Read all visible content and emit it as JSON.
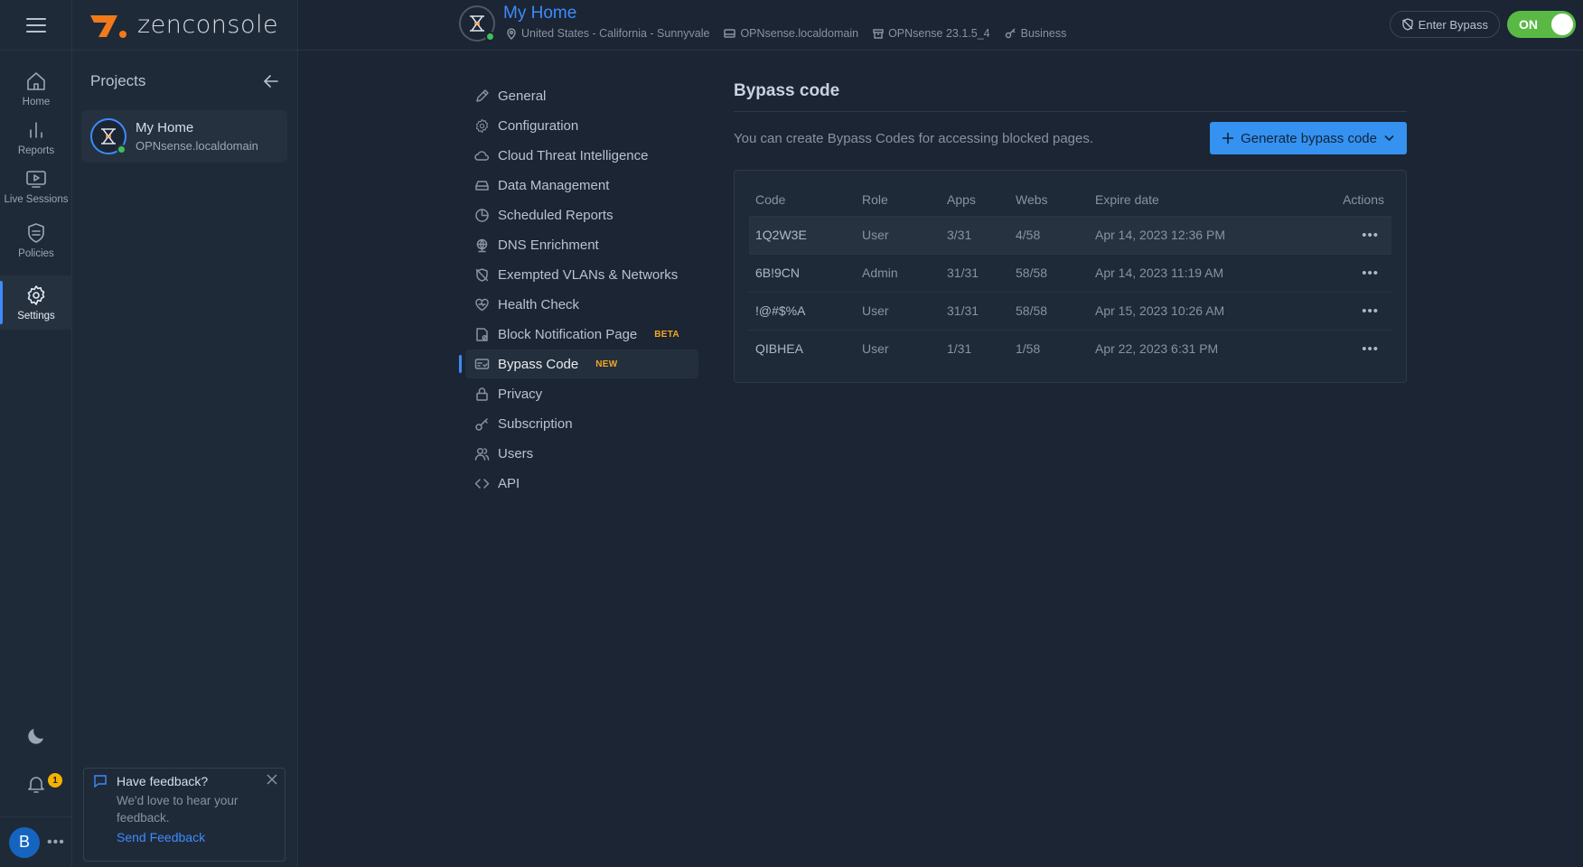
{
  "rail": {
    "items": [
      {
        "label": "Home",
        "icon": "home-icon"
      },
      {
        "label": "Reports",
        "icon": "bar-chart-icon"
      },
      {
        "label": "Live Sessions",
        "icon": "play-icon"
      },
      {
        "label": "Policies",
        "icon": "shield-icon"
      },
      {
        "label": "Settings",
        "icon": "gear-icon"
      }
    ],
    "notification_count": "1",
    "user_initial": "B"
  },
  "logo": {
    "text": "zenconsole"
  },
  "projects": {
    "title": "Projects",
    "items": [
      {
        "name": "My Home",
        "host": "OPNsense.localdomain"
      }
    ]
  },
  "feedback": {
    "title": "Have feedback?",
    "body": "We'd love to hear your feedback.",
    "link": "Send Feedback"
  },
  "header": {
    "title": "My Home",
    "location": "United States - California - Sunnyvale",
    "host": "OPNsense.localdomain",
    "version": "OPNsense 23.1.5_4",
    "plan": "Business",
    "bypass_button": "Enter Bypass",
    "toggle_label": "ON"
  },
  "settings_nav": [
    {
      "label": "General",
      "icon": "pencil-icon",
      "tag": ""
    },
    {
      "label": "Configuration",
      "icon": "gear-icon",
      "tag": ""
    },
    {
      "label": "Cloud Threat Intelligence",
      "icon": "cloud-icon",
      "tag": ""
    },
    {
      "label": "Data Management",
      "icon": "drive-icon",
      "tag": ""
    },
    {
      "label": "Scheduled Reports",
      "icon": "pie-chart-icon",
      "tag": ""
    },
    {
      "label": "DNS Enrichment",
      "icon": "globe-icon",
      "tag": ""
    },
    {
      "label": "Exempted VLANs & Networks",
      "icon": "shield-off-icon",
      "tag": ""
    },
    {
      "label": "Health Check",
      "icon": "heart-icon",
      "tag": ""
    },
    {
      "label": "Block Notification Page",
      "icon": "page-block-icon",
      "tag": "BETA"
    },
    {
      "label": "Bypass Code",
      "icon": "bypass-code-icon",
      "tag": "NEW"
    },
    {
      "label": "Privacy",
      "icon": "lock-icon",
      "tag": ""
    },
    {
      "label": "Subscription",
      "icon": "key-icon",
      "tag": ""
    },
    {
      "label": "Users",
      "icon": "users-icon",
      "tag": ""
    },
    {
      "label": "API",
      "icon": "code-icon",
      "tag": ""
    }
  ],
  "bypass": {
    "title": "Bypass code",
    "description": "You can create Bypass Codes for accessing blocked pages.",
    "generate_button": "Generate bypass code",
    "columns": [
      "Code",
      "Role",
      "Apps",
      "Webs",
      "Expire date",
      "Actions"
    ],
    "rows": [
      {
        "code": "1Q2W3E",
        "role": "User",
        "apps": "3/31",
        "webs": "4/58",
        "expire": "Apr 14, 2023 12:36 PM"
      },
      {
        "code": "6B!9CN",
        "role": "Admin",
        "apps": "31/31",
        "webs": "58/58",
        "expire": "Apr 14, 2023 11:19 AM"
      },
      {
        "code": "!@#$%A",
        "role": "User",
        "apps": "31/31",
        "webs": "58/58",
        "expire": "Apr 15, 2023 10:26 AM"
      },
      {
        "code": "QIBHEA",
        "role": "User",
        "apps": "1/31",
        "webs": "1/58",
        "expire": "Apr 22, 2023 6:31 PM"
      }
    ]
  },
  "colors": {
    "accent": "#3d8bfd",
    "toggle_on": "#5ab945",
    "badge": "#f5b300",
    "tag": "#f5a623"
  }
}
